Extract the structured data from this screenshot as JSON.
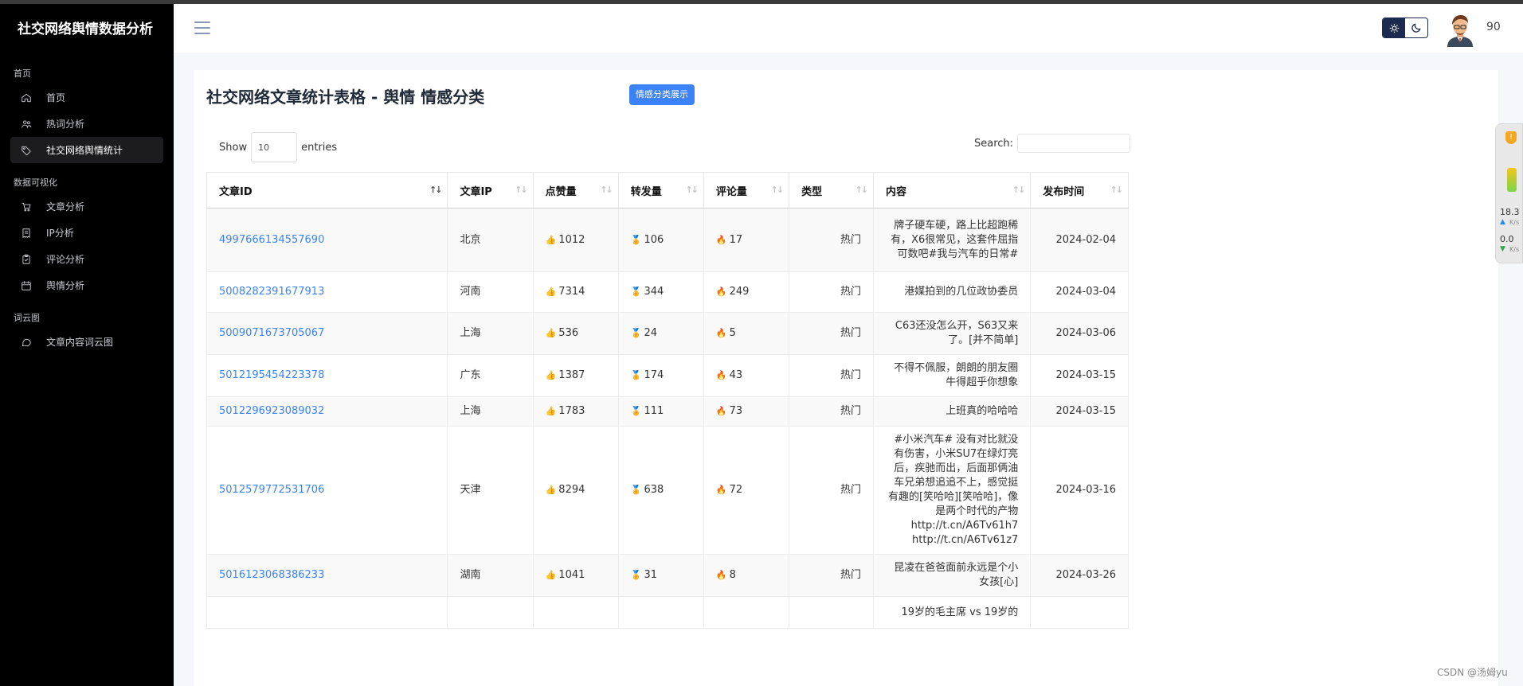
{
  "app": {
    "title": "社交网络舆情数据分析"
  },
  "sidebar": {
    "sections": [
      {
        "label": "首页",
        "items": [
          {
            "label": "首页",
            "icon": "home-icon",
            "active": false
          },
          {
            "label": "热词分析",
            "icon": "users-icon",
            "active": false
          },
          {
            "label": "社交网络舆情统计",
            "icon": "tag-icon",
            "active": true
          }
        ]
      },
      {
        "label": "数据可视化",
        "items": [
          {
            "label": "文章分析",
            "icon": "cart-icon",
            "active": false
          },
          {
            "label": "IP分析",
            "icon": "receipt-icon",
            "active": false
          },
          {
            "label": "评论分析",
            "icon": "clipboard-icon",
            "active": false
          },
          {
            "label": "舆情分析",
            "icon": "calendar-icon",
            "active": false
          }
        ]
      },
      {
        "label": "词云图",
        "items": [
          {
            "label": "文章内容词云图",
            "icon": "chat-icon",
            "active": false
          }
        ]
      }
    ]
  },
  "header": {
    "user_value": "90"
  },
  "main": {
    "title": "社交网络文章统计表格 - 舆情 情感分类",
    "category_button": "情感分类展示",
    "show_label": "Show",
    "entries_value": "10",
    "entries_label": "entries",
    "search_label": "Search:"
  },
  "table": {
    "columns": [
      "文章ID",
      "文章IP",
      "点赞量",
      "转发量",
      "评论量",
      "类型",
      "内容",
      "发布时间"
    ],
    "rows": [
      {
        "id": "4997666134557690",
        "ip": "北京",
        "likes": "1012",
        "shares": "106",
        "comments": "17",
        "type": "热门",
        "content": "牌子硬车硬，路上比超跑稀有，X6很常见，这套件屈指可数吧#我与汽车的日常#",
        "date": "2024-02-04"
      },
      {
        "id": "5008282391677913",
        "ip": "河南",
        "likes": "7314",
        "shares": "344",
        "comments": "249",
        "type": "热门",
        "content": "港媒拍到的几位政协委员",
        "date": "2024-03-04"
      },
      {
        "id": "5009071673705067",
        "ip": "上海",
        "likes": "536",
        "shares": "24",
        "comments": "5",
        "type": "热门",
        "content": "C63还没怎么开，S63又来了。[并不简单]",
        "date": "2024-03-06"
      },
      {
        "id": "5012195454223378",
        "ip": "广东",
        "likes": "1387",
        "shares": "174",
        "comments": "43",
        "type": "热门",
        "content": "不得不佩服，朗朗的朋友圈牛得超乎你想象",
        "date": "2024-03-15"
      },
      {
        "id": "5012296923089032",
        "ip": "上海",
        "likes": "1783",
        "shares": "111",
        "comments": "73",
        "type": "热门",
        "content": "上班真的哈哈哈",
        "date": "2024-03-15"
      },
      {
        "id": "5012579772531706",
        "ip": "天津",
        "likes": "8294",
        "shares": "638",
        "comments": "72",
        "type": "热门",
        "content": "#小米汽车# 没有对比就没有伤害，小米SU7在绿灯亮后，疾驰而出，后面那俩油车兄弟想追追不上，感觉挺有趣的[笑哈哈][笑哈哈]，像是两个时代的产物 http://t.cn/A6Tv61h7 http://t.cn/A6Tv61z7",
        "date": "2024-03-16"
      },
      {
        "id": "5016123068386233",
        "ip": "湖南",
        "likes": "1041",
        "shares": "31",
        "comments": "8",
        "type": "热门",
        "content": "昆凌在爸爸面前永远是个小女孩[心]",
        "date": "2024-03-26"
      },
      {
        "id": "",
        "ip": "",
        "likes": "",
        "shares": "",
        "comments": "",
        "type": "",
        "content": "19岁的毛主席 vs 19岁的",
        "date": ""
      }
    ],
    "like_icon": "👍",
    "share_icon": "🏅",
    "comment_icon": "🔥"
  },
  "widget": {
    "up_value": "18.3",
    "up_unit": "K/s",
    "down_value": "0.0",
    "down_unit": "K/s",
    "badge": "!"
  },
  "watermark": "CSDN @汤姆yu"
}
